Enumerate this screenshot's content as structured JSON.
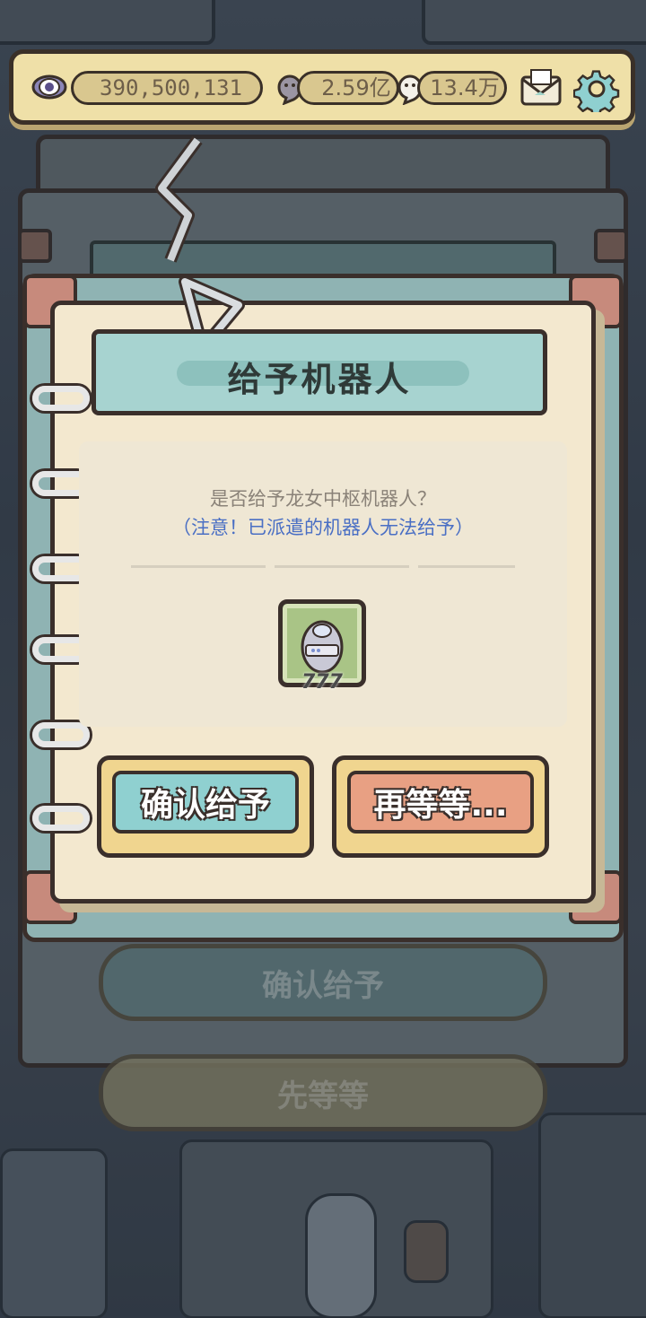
{
  "resources": {
    "eye_value": "390,500,131",
    "ghost_gray_value": "2.59亿",
    "ghost_white_value": "13.4万"
  },
  "icons": {
    "eye": "eye-icon",
    "ghost_gray": "ghost-gray-icon",
    "ghost_white": "ghost-white-icon",
    "mail": "mail-icon",
    "settings": "gear-icon",
    "robot_egg": "robot-egg-icon"
  },
  "dialog": {
    "title": "给予机器人",
    "question": "是否给予龙女中枢机器人？",
    "warning": "（注意！已派遣的机器人无法给予）",
    "item_count": "777",
    "confirm_label": "确认给予",
    "wait_label": "再等等..."
  },
  "background_buttons": {
    "confirm_label": "确认给予",
    "wait_label": "先等等"
  },
  "colors": {
    "confirm": "#8fd0d0",
    "wait": "#e8a083",
    "warning_text": "#4a6fc4",
    "topbar": "#efe0a8"
  }
}
